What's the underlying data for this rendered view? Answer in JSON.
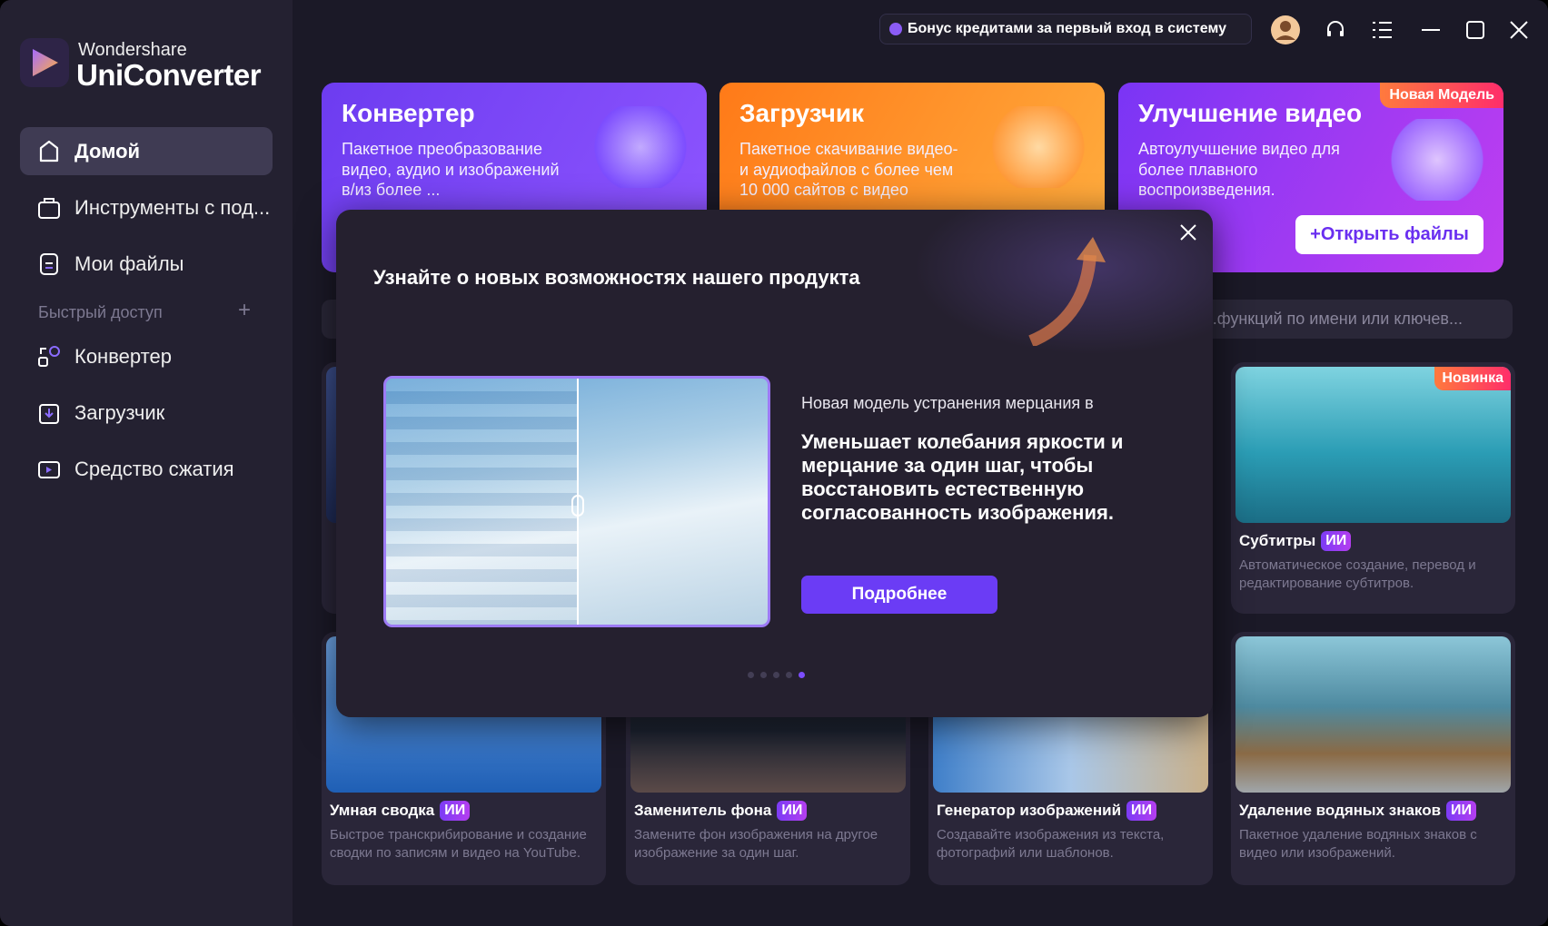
{
  "app": {
    "brand_top": "Wondershare",
    "brand_name": "UniConverter"
  },
  "sidebar": {
    "items": [
      {
        "label": "Домой",
        "icon": "home-icon"
      },
      {
        "label": "Инструменты с под...",
        "icon": "ai-toolbox-icon"
      },
      {
        "label": "Мои файлы",
        "icon": "file-icon"
      }
    ],
    "quick_access_label": "Быстрый доступ",
    "quick_add": "+",
    "quick_items": [
      {
        "label": "Конвертер",
        "icon": "converter-icon"
      },
      {
        "label": "Загрузчик",
        "icon": "download-icon"
      },
      {
        "label": "Средство сжатия",
        "icon": "compress-icon"
      }
    ]
  },
  "topbar": {
    "bonus": "Бонус кредитами за первый вход в систему"
  },
  "banners": [
    {
      "title": "Конвертер",
      "desc": "Пакетное преобразование видео, аудио и изображений в/из более ..."
    },
    {
      "title": "Загрузчик",
      "desc": "Пакетное скачивание видео- и аудиофайлов с более чем 10 000 сайтов с видео"
    },
    {
      "title": "Улучшение видео",
      "desc": "Автоулучшение видео для более плавного воспроизведения.",
      "badge": "Новая Модель",
      "button": "+Открыть файлы"
    }
  ],
  "search": {
    "placeholder": "...функций по имени или ключев..."
  },
  "cards": [
    {
      "title": "Субтитры",
      "ai": "ИИ",
      "badge": "Новинка",
      "desc": "Автоматическое создание, перевод и редактирование субтитров."
    },
    {
      "title": "Умная сводка",
      "ai": "ИИ",
      "desc": "Быстрое транскрибирование и создание сводки по записям и видео на YouTube."
    },
    {
      "title": "Заменитель фона",
      "ai": "ИИ",
      "desc": "Замените фон изображения на другое изображение за один шаг."
    },
    {
      "title": "Генератор изображений",
      "ai": "ИИ",
      "desc": "Создавайте изображения из текста, фотографий или шаблонов."
    },
    {
      "title": "Удаление водяных знаков",
      "ai": "ИИ",
      "desc": "Пакетное удаление водяных знаков с видео или изображений."
    }
  ],
  "modal": {
    "title": "Узнайте о новых возможностях нашего продукта",
    "subtitle": "Новая модель устранения мерцания в",
    "body": "Уменьшает колебания яркости и мерцание за один шаг, чтобы восстановить естественную согласованность изображения.",
    "button": "Подробнее",
    "slides_total": 5,
    "slide_active": 5
  },
  "colors": {
    "accent": "#6b3cf5",
    "sidebar": "#242131",
    "bg": "#1b1927"
  }
}
